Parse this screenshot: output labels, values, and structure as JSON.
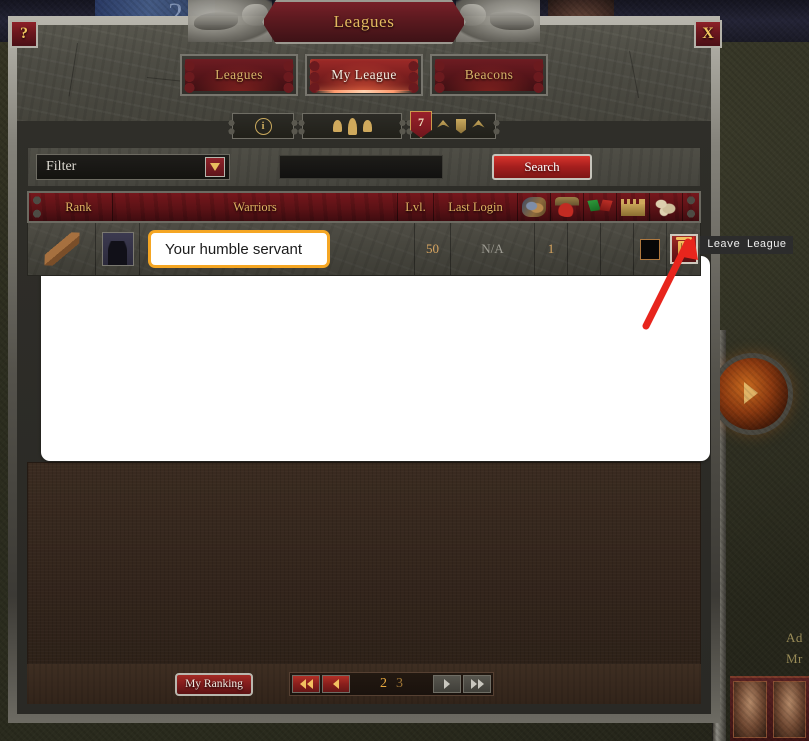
{
  "window": {
    "title": "Leagues",
    "help_label": "?",
    "close_label": "X"
  },
  "tabs": [
    {
      "label": "Leagues",
      "active": false
    },
    {
      "label": "My League",
      "active": true
    },
    {
      "label": "Beacons",
      "active": false
    }
  ],
  "toolbar": {
    "info_glyph": "i",
    "info_name": "info-icon",
    "members_name": "members-icon",
    "league_count": "7",
    "banners_name": "banners-icon"
  },
  "filter": {
    "selected": "Filter",
    "dropdown_name": "filter-dropdown-arrow",
    "search_value": "",
    "search_placeholder": "",
    "search_button": "Search"
  },
  "table": {
    "columns": [
      {
        "key": "rank",
        "label": "Rank",
        "type": "text"
      },
      {
        "key": "warriors",
        "label": "Warriors",
        "type": "text"
      },
      {
        "key": "lvl",
        "label": "Lvl.",
        "type": "text"
      },
      {
        "key": "login",
        "label": "Last Login",
        "type": "text"
      },
      {
        "key": "gauntlet",
        "label": "",
        "type": "icon",
        "icon": "gauntlet-icon"
      },
      {
        "key": "potion",
        "label": "",
        "type": "icon",
        "icon": "blood-potion-icon"
      },
      {
        "key": "flags",
        "label": "",
        "type": "icon",
        "icon": "crossed-flags-icon"
      },
      {
        "key": "castle",
        "label": "",
        "type": "icon",
        "icon": "castle-icon"
      },
      {
        "key": "bones",
        "label": "",
        "type": "icon",
        "icon": "bones-icon"
      }
    ],
    "rows": [
      {
        "rank_icon": "club-rank-icon",
        "avatar": "player-avatar",
        "name": "Your humble servant",
        "name_highlighted": true,
        "lvl": "50",
        "last_login": "N/A",
        "gauntlet": "1",
        "potion": "",
        "flags": "",
        "castle": "checkbox",
        "action": "leave-league"
      }
    ]
  },
  "tooltip": {
    "text": "Leave League"
  },
  "footer": {
    "my_ranking": "My Ranking",
    "first_label": "◀◀",
    "prev_label": "◀",
    "next_label": "▶",
    "last_label": "▶▶",
    "pages": [
      {
        "label": "2",
        "current": true
      },
      {
        "label": "3",
        "current": false
      }
    ]
  },
  "background": {
    "top_number": "2",
    "right_text_line1": "Ad",
    "right_text_line2": "Mr"
  },
  "colors": {
    "accent_gold": "#e3b95f",
    "tab_red": "#6e1c22",
    "tab_active_red": "#9d2a28",
    "highlight_orange": "#f5a623",
    "panel_white": "#ffffff",
    "brown_panel": "#33251c",
    "stone_border": "#85837b"
  }
}
